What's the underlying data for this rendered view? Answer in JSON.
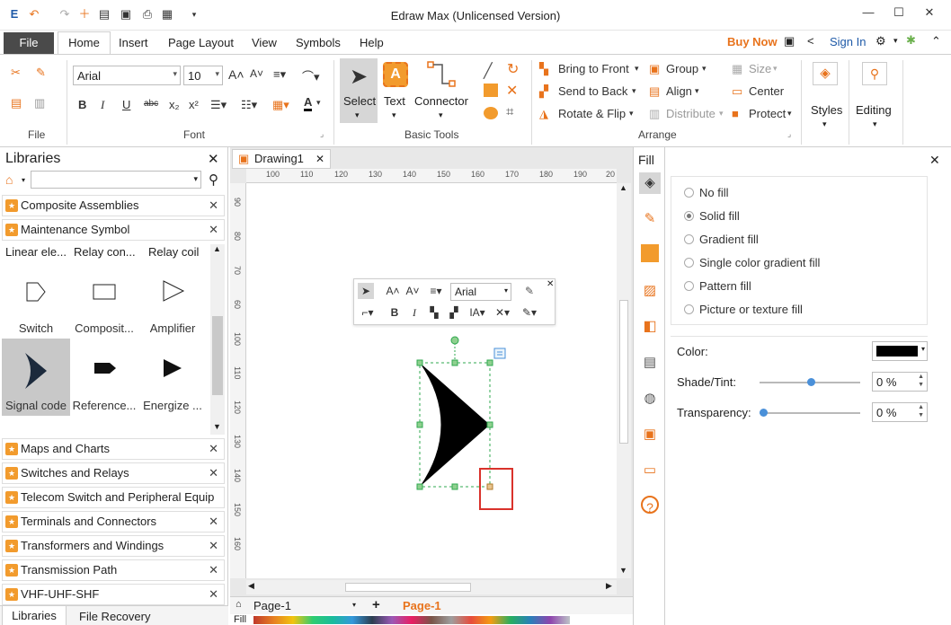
{
  "app": {
    "title": "Edraw Max (Unlicensed Version)"
  },
  "menu": {
    "file": "File",
    "tabs": [
      "Home",
      "Insert",
      "Page Layout",
      "View",
      "Symbols",
      "Help"
    ],
    "buy_now": "Buy Now",
    "sign_in": "Sign In"
  },
  "ribbon": {
    "groups": {
      "file": "File",
      "font": "Font",
      "basic_tools": "Basic Tools",
      "arrange": "Arrange"
    },
    "font_name": "Arial",
    "font_size": "10",
    "select": "Select",
    "text": "Text",
    "connector": "Connector",
    "bring_to_front": "Bring to Front",
    "send_to_back": "Send to Back",
    "rotate_flip": "Rotate & Flip",
    "group": "Group",
    "align": "Align",
    "distribute": "Distribute",
    "size": "Size",
    "center": "Center",
    "protect": "Protect",
    "styles": "Styles",
    "editing": "Editing",
    "text_icon_letter": "A"
  },
  "libraries": {
    "title": "Libraries",
    "categories_top": [
      "Composite Assemblies",
      "Maintenance Symbol"
    ],
    "shape_row1_labels": [
      "Linear ele...",
      "Relay con...",
      "Relay coil"
    ],
    "shapes": [
      {
        "label": "Switch"
      },
      {
        "label": "Composit..."
      },
      {
        "label": "Amplifier"
      },
      {
        "label": "Signal code",
        "selected": true
      },
      {
        "label": "Reference..."
      },
      {
        "label": "Energize ..."
      }
    ],
    "categories_bottom": [
      "Maps and Charts",
      "Switches and Relays",
      "Telecom Switch and Peripheral Equip",
      "Terminals and Connectors",
      "Transformers and Windings",
      "Transmission Path",
      "VHF-UHF-SHF"
    ],
    "bottom_tabs": [
      "Libraries",
      "File Recovery"
    ]
  },
  "canvas": {
    "doc_tab": "Drawing1",
    "hruler_ticks": [
      "100",
      "110",
      "120",
      "130",
      "140",
      "150",
      "160",
      "170",
      "180",
      "190",
      "20"
    ],
    "vruler_ticks": [
      "90",
      "80",
      "70",
      "60",
      "100",
      "110",
      "120",
      "130",
      "140",
      "150",
      "160"
    ],
    "float_font": "Arial",
    "page_select": "Page-1",
    "page_tab": "Page-1",
    "fill_label": "Fill"
  },
  "fill_panel": {
    "title": "Fill",
    "options": [
      {
        "label": "No fill",
        "selected": false
      },
      {
        "label": "Solid fill",
        "selected": true
      },
      {
        "label": "Gradient fill",
        "selected": false
      },
      {
        "label": "Single color gradient fill",
        "selected": false
      },
      {
        "label": "Pattern fill",
        "selected": false
      },
      {
        "label": "Picture or texture fill",
        "selected": false
      }
    ],
    "color_label": "Color:",
    "color_value": "#000000",
    "shade_label": "Shade/Tint:",
    "shade_value": "0 %",
    "transparency_label": "Transparency:",
    "transparency_value": "0 %"
  },
  "colors": {
    "accent_orange": "#f29b2d",
    "file_tab": "#4a4a4a",
    "highlight_red": "#d9322b",
    "selection_green": "#2fa84f"
  }
}
